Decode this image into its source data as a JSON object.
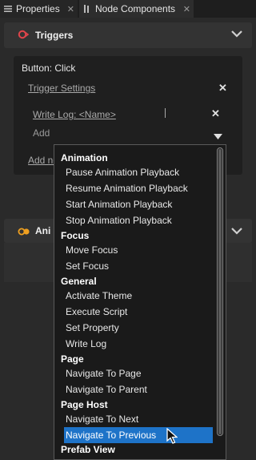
{
  "tabs": [
    {
      "label": "Properties",
      "close": "✕"
    },
    {
      "label": "Node Components",
      "close": "✕"
    }
  ],
  "triggers": {
    "title": "Triggers",
    "event_label": "Button: Click",
    "settings_link": "Trigger Settings",
    "action_link": "Write Log: <Name>",
    "add_placeholder": "Add",
    "add_node_link": "Add no",
    "close": "✕"
  },
  "animations": {
    "title": "Ani"
  },
  "dropdown": {
    "groups": [
      {
        "category": "Animation",
        "items": [
          "Pause Animation Playback",
          "Resume Animation Playback",
          "Start Animation Playback",
          "Stop Animation Playback"
        ]
      },
      {
        "category": "Focus",
        "items": [
          "Move Focus",
          "Set Focus"
        ]
      },
      {
        "category": "General",
        "items": [
          "Activate Theme",
          "Execute Script",
          "Set Property",
          "Write Log"
        ]
      },
      {
        "category": "Page",
        "items": [
          "Navigate To Page",
          "Navigate To Parent"
        ]
      },
      {
        "category": "Page Host",
        "items": [
          "Navigate To Next",
          "Navigate To Previous"
        ]
      },
      {
        "category": "Prefab View",
        "items": []
      }
    ],
    "selected": "Navigate To Previous"
  },
  "colors": {
    "selection": "#1e73c8",
    "trigger_icon": "#e0454b",
    "anim_icon": "#f0a020"
  }
}
